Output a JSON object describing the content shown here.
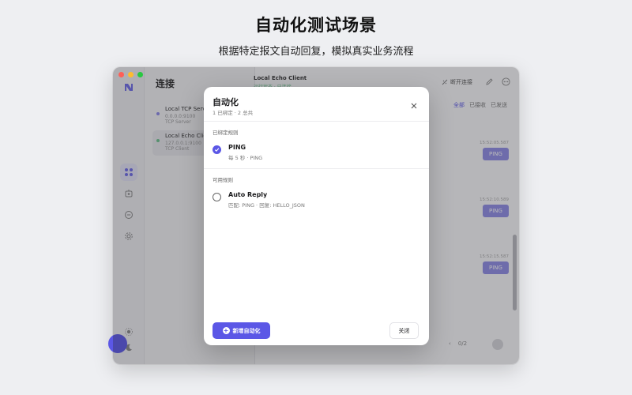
{
  "hero": {
    "title": "自动化测试场景",
    "subtitle": "根据特定报文自动回复，模拟真实业务流程"
  },
  "sidebar": {
    "title": "连接",
    "connections": [
      {
        "name": "Local TCP Server",
        "address": "0.0.0.0:9100",
        "type": "TCP Server",
        "dot_color": "#8b87e8"
      },
      {
        "name": "Local Echo Client",
        "address": "127.0.0.1:9100",
        "type": "TCP Client",
        "dot_color": "#6cc28c"
      }
    ]
  },
  "main": {
    "title": "Local Echo Client",
    "status": "运行状态 · 已连接",
    "disconnect_label": "断开连接",
    "filters": {
      "all": "全部",
      "received": "已接收",
      "sent": "已发送"
    },
    "messages": [
      {
        "time": "15:52:05.587",
        "text": "PING"
      },
      {
        "time": "15:52:10.589",
        "text": "PING"
      },
      {
        "time": "15:52:15.587",
        "text": "PING"
      }
    ],
    "pagination": "0/2"
  },
  "modal": {
    "title": "自动化",
    "subtitle": "1 已绑定 · 2 总共",
    "bound_section_label": "已绑定规则",
    "available_section_label": "可用规则",
    "bound_rules": [
      {
        "name": "PING",
        "description": "每 5 秒 · PING",
        "checked": true
      }
    ],
    "available_rules": [
      {
        "name": "Auto Reply",
        "description": "匹配: PING · 回复: HELLO_JSON",
        "checked": false
      }
    ],
    "add_button_label": "新增自动化",
    "close_button_label": "关闭"
  },
  "colors": {
    "accent": "#5b57e6",
    "bubble": "#8f8ce6",
    "connected": "#6cc28c"
  }
}
